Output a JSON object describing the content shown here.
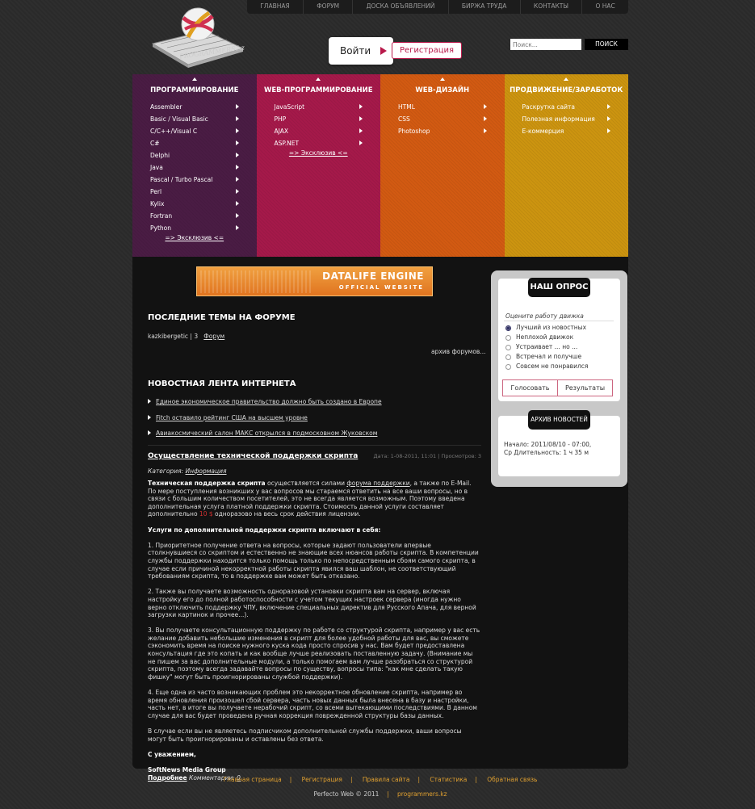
{
  "topnav": [
    "ГЛАВНАЯ",
    "ФОРУМ",
    "ДОСКА ОБЪЯВЛЕНИЙ",
    "БИРЖА ТРУДА",
    "КОНТАКТЫ",
    "О НАС"
  ],
  "logo": {
    "text": "PROGRAMMERS.kz"
  },
  "auth": {
    "login": "Войти",
    "register": "Регистрация"
  },
  "search": {
    "placeholder": "Поиск...",
    "button": "ПОИСК"
  },
  "categories": [
    {
      "title": "ПРОГРАММИРОВАНИЕ",
      "color": "#4a1c44",
      "items": [
        "Assembler",
        "Basic / Visual Basic",
        "C/C++/Visual C",
        "C#",
        "Delphi",
        "Java",
        "Pascal / Turbo Pascal",
        "Perl",
        "Kylix",
        "Fortran",
        "Python"
      ],
      "extra": "=> Эксклюзив <="
    },
    {
      "title": "WEB-ПРОГРАММИРОВАНИЕ",
      "color": "#a5194a",
      "items": [
        "JavaScript",
        "PHP",
        "AJAX",
        "ASP.NET"
      ],
      "extra": "=> Эксклюзив <="
    },
    {
      "title": "WEB-ДИЗАЙН",
      "color": "#d25a12",
      "items": [
        "HTML",
        "CSS",
        "Photoshop"
      ],
      "extra": ""
    },
    {
      "title": "ПРОДВИЖЕНИЕ/ЗАРАБОТОК",
      "color": "#cc9410",
      "items": [
        "Раскрутка сайта",
        "Полезная информация",
        "Е-коммерция"
      ],
      "extra": ""
    }
  ],
  "banner": {
    "line1": "DATALIFE ENGINE",
    "line2": "OFFICIAL WEBSITE"
  },
  "forum": {
    "heading": "ПОСЛЕДНИЕ ТЕМЫ НА ФОРУМЕ",
    "author": "kazkibergetic",
    "count": "3",
    "link": "Форум",
    "archive": "архив форумов..."
  },
  "news": {
    "heading": "НОВОСТНАЯ ЛЕНТА ИНТЕРНЕТА",
    "items": [
      "Единое экономическое правительство должно быть создано в Европе",
      "Fitch оставило рейтинг США на высшем уровне",
      "Авиакосмический салон МАКС открылся в подмосковном Жуковском"
    ]
  },
  "article": {
    "title": "Осуществление технической поддержки скрипта",
    "meta": "Дата: 1-08-2011, 11:01 | Просмотров: 3",
    "category_label": "Категория:",
    "category": "Информация",
    "intro_bold": "Техническая поддержка скрипта",
    "intro_1": " осуществляется силами ",
    "intro_link": "форума поддержки",
    "intro_2": ", а также по E-Mail. По мере поступления возникших у вас вопросов мы стараемся ответить на все ваши вопросы, но в связи с большим количеством посетителей, это не всегда является возможным. Поэтому введена дополнительная услуга платной поддержки скрипта. Стоимость данной услуги составляет дополнительно ",
    "price": "10 $",
    "intro_3": " одноразово на весь срок действия лицензии.",
    "services_heading": "Услуги по дополнительной поддержки скрипта включают в себя:",
    "p1": "1. Приоритетное получение ответа на вопросы, которые задают пользователи впервые столкнувшиеся со скриптом и естественно не знающие всех нюансов работы скрипта. В компетенции службы поддержки находится только помощь только по непосредственным сбоям самого скрипта, в случае если причиной некорректной работы скрипта явился ваш шаблон, не соответствующий требованиям скрипта, то в поддержке вам может быть отказано.",
    "p2": "2. Также вы получаете возможность одноразовой установки скрипта вам на сервер, включая настройку его до полной работоспособности с учетом текущих настроек сервера (иногда нужно верно отключить поддержку ЧПУ, включение специальных директив для Русского Апача, для верной загрузки картинок и прочее...).",
    "p3": "3. Вы получаете консультационную поддержку по работе со структурой скрипта, например у вас есть желание добавить небольшие изменения в скрипт для более удобной работы для вас, вы сможете сэкономить время на поиске нужного куска кода просто спросив у нас. Вам будет предоставлена консультация где это копать и как вообще лучше реализовать поставленную задачу. (Внимание мы не пишем за вас дополнительные модули, а только помогаем вам лучше разобраться со структурой скрипта, поэтому всегда задавайте вопросы по существу, вопросы типа: \"как мне сделать такую фишку\" могут быть проигнорированы службой поддержки).",
    "p4": "4. Еще одна из часто возникающих проблем это некорректное обновление скрипта, например во время обновления произошел сбой сервера, часть новых данных была внесена в базу и настройки, часть нет, в итоге вы получаете нерабочий скрипт, со всеми вытекающими последствиями. В данном случае для вас будет проведена ручная коррекция поврежденной структуры базы данных.",
    "p5": "В случае если вы не являетесь подписчиком дополнительной службы поддержки, ваши вопросы могут быть проигнорированы и оставлены без ответа.",
    "regards": "С уважением,",
    "signature": "SoftNews Media Group",
    "more": "Подробнее",
    "comments_label": "Комментарии:",
    "comments": "0"
  },
  "poll": {
    "title": "НАШ ОПРОС",
    "question": "Оцените работу движка",
    "options": [
      "Лучший из новостных",
      "Неплохой движок",
      "Устраивает ... но ...",
      "Встречал и получше",
      "Совсем не понравился"
    ],
    "selected": 0,
    "vote": "Голосовать",
    "results": "Результаты"
  },
  "archive": {
    "title": "АРХИВ НОВОСТЕЙ",
    "start": "Начало: 2011/08/10 - 07:00,",
    "duration": "Ср Длительность: 1 ч 35 м"
  },
  "footer": {
    "links": [
      "Главная страница",
      "Регистрация",
      "Правила сайта",
      "Статистика",
      "Обратная связь"
    ],
    "copy": "Perfecto Web © 2011",
    "site": "programmers.kz"
  }
}
